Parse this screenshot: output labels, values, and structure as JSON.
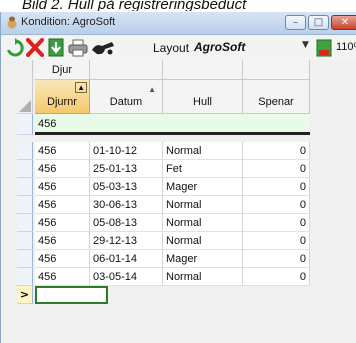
{
  "document": {
    "caption_fragment": "Bild 2. Hull på registreringsbeduct"
  },
  "window": {
    "title": "Kondition: AgroSoft",
    "minimize": "–",
    "maximize": "□",
    "close": "✕"
  },
  "toolbar": {
    "layout_label": "Layout",
    "brand": "AgroSoft",
    "zoom": "110%",
    "icons": [
      "refresh-icon",
      "delete-icon",
      "export-icon",
      "print-icon",
      "layout-icon",
      "dropdown-icon",
      "zoom-icon"
    ]
  },
  "grid": {
    "group_header": "Djur",
    "columns": [
      "Djurnr",
      "Datum",
      "Hull",
      "Spenar"
    ],
    "filter_value": "456",
    "rows": [
      [
        "456",
        "01-10-12",
        "Normal",
        "0"
      ],
      [
        "456",
        "25-01-13",
        "Fet",
        "0"
      ],
      [
        "456",
        "05-03-13",
        "Mager",
        "0"
      ],
      [
        "456",
        "30-06-13",
        "Normal",
        "0"
      ],
      [
        "456",
        "05-08-13",
        "Normal",
        "0"
      ],
      [
        "456",
        "29-12-13",
        "Normal",
        "0"
      ],
      [
        "456",
        "06-01-14",
        "Mager",
        "0"
      ],
      [
        "456",
        "03-05-14",
        "Normal",
        "0"
      ]
    ],
    "new_row_marker": ">"
  },
  "colors": {
    "selected_header": "#f4c96b",
    "filter_row": "#e8fae8",
    "titlebar": "#c8d9ee"
  }
}
